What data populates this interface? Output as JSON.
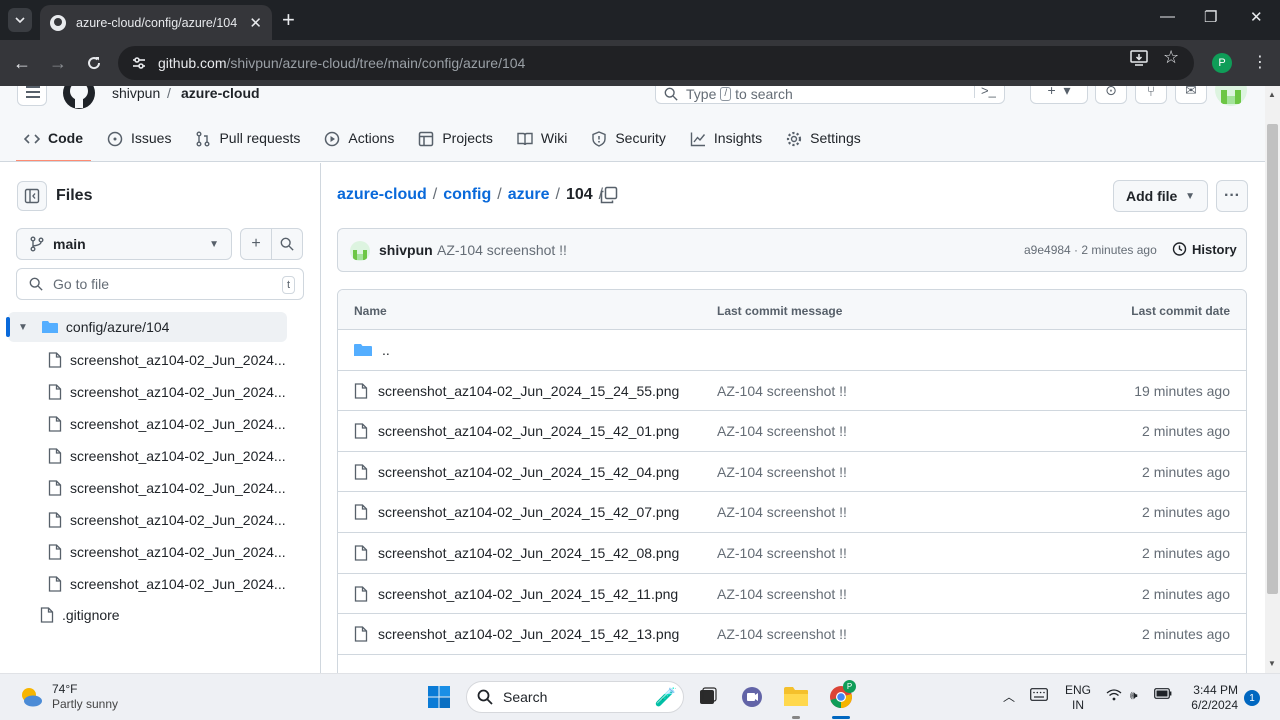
{
  "browser": {
    "tab_title": "azure-cloud/config/azure/104 a",
    "url_host": "github.com",
    "url_path": "/shivpun/azure-cloud/tree/main/config/azure/104",
    "profile_initial": "P"
  },
  "header": {
    "owner": "shivpun",
    "separator": "/",
    "repo": "azure-cloud",
    "search_prefix": "Type",
    "search_key": "/",
    "search_suffix": "to search"
  },
  "repo_nav": [
    {
      "label": "Code",
      "icon": "code-icon",
      "selected": true
    },
    {
      "label": "Issues",
      "icon": "issue-icon"
    },
    {
      "label": "Pull requests",
      "icon": "pull-request-icon"
    },
    {
      "label": "Actions",
      "icon": "play-icon"
    },
    {
      "label": "Projects",
      "icon": "table-icon"
    },
    {
      "label": "Wiki",
      "icon": "book-icon"
    },
    {
      "label": "Security",
      "icon": "shield-icon"
    },
    {
      "label": "Insights",
      "icon": "graph-icon"
    },
    {
      "label": "Settings",
      "icon": "gear-icon"
    }
  ],
  "sidebar": {
    "title": "Files",
    "branch": "main",
    "goto_placeholder": "Go to file",
    "goto_shortcut": "t",
    "folder": "config/azure/104",
    "items": [
      "screenshot_az104-02_Jun_2024...",
      "screenshot_az104-02_Jun_2024...",
      "screenshot_az104-02_Jun_2024...",
      "screenshot_az104-02_Jun_2024...",
      "screenshot_az104-02_Jun_2024...",
      "screenshot_az104-02_Jun_2024...",
      "screenshot_az104-02_Jun_2024...",
      "screenshot_az104-02_Jun_2024..."
    ],
    "gitignore": ".gitignore"
  },
  "breadcrumb": {
    "repo": "azure-cloud",
    "p1": "config",
    "p2": "azure",
    "current": "104",
    "trailing": "/"
  },
  "actions": {
    "add_file": "Add file",
    "more": "···"
  },
  "commit": {
    "author": "shivpun",
    "message": "AZ-104 screenshot !!",
    "hash_time": "a9e4984 · 2 minutes ago",
    "history": "History"
  },
  "table": {
    "headers": {
      "name": "Name",
      "message": "Last commit message",
      "date": "Last commit date"
    },
    "parent": "..",
    "rows": [
      {
        "name": "screenshot_az104-02_Jun_2024_15_24_55.png",
        "message": "AZ-104 screenshot !!",
        "date": "19 minutes ago"
      },
      {
        "name": "screenshot_az104-02_Jun_2024_15_42_01.png",
        "message": "AZ-104 screenshot !!",
        "date": "2 minutes ago"
      },
      {
        "name": "screenshot_az104-02_Jun_2024_15_42_04.png",
        "message": "AZ-104 screenshot !!",
        "date": "2 minutes ago"
      },
      {
        "name": "screenshot_az104-02_Jun_2024_15_42_07.png",
        "message": "AZ-104 screenshot !!",
        "date": "2 minutes ago"
      },
      {
        "name": "screenshot_az104-02_Jun_2024_15_42_08.png",
        "message": "AZ-104 screenshot !!",
        "date": "2 minutes ago"
      },
      {
        "name": "screenshot_az104-02_Jun_2024_15_42_11.png",
        "message": "AZ-104 screenshot !!",
        "date": "2 minutes ago"
      },
      {
        "name": "screenshot_az104-02_Jun_2024_15_42_13.png",
        "message": "AZ-104 screenshot !!",
        "date": "2 minutes ago"
      }
    ]
  },
  "taskbar": {
    "temp": "74°F",
    "condition": "Partly sunny",
    "search": "Search",
    "lang1": "ENG",
    "lang2": "IN",
    "time": "3:44 PM",
    "date": "6/2/2024",
    "notifications": "1"
  },
  "colors": {
    "accent": "#0969da",
    "selected_underline": "#fd8c73",
    "folder": "#54aeff"
  }
}
